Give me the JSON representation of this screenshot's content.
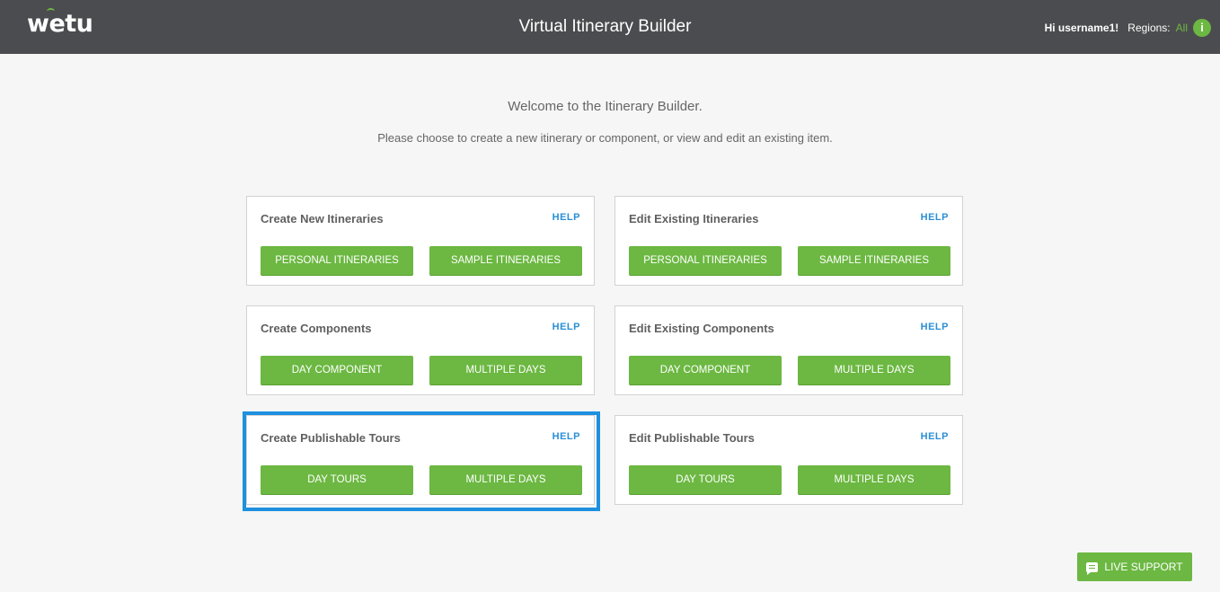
{
  "header": {
    "logo": "wetu",
    "title": "Virtual Itinerary Builder",
    "greeting": "Hi username1!",
    "regions_label": "Regions:",
    "regions_value": "All",
    "info_icon": "i"
  },
  "intro": {
    "welcome": "Welcome to the Itinerary Builder.",
    "subtitle": "Please choose to create a new itinerary or component, or view and edit an existing item."
  },
  "cards": [
    {
      "title": "Create New Itineraries",
      "help": "HELP",
      "buttons": [
        "PERSONAL ITINERARIES",
        "SAMPLE ITINERARIES"
      ]
    },
    {
      "title": "Edit Existing Itineraries",
      "help": "HELP",
      "buttons": [
        "PERSONAL ITINERARIES",
        "SAMPLE ITINERARIES"
      ]
    },
    {
      "title": "Create Components",
      "help": "HELP",
      "buttons": [
        "DAY COMPONENT",
        "MULTIPLE DAYS"
      ]
    },
    {
      "title": "Edit Existing Components",
      "help": "HELP",
      "buttons": [
        "DAY COMPONENT",
        "MULTIPLE DAYS"
      ]
    },
    {
      "title": "Create Publishable Tours",
      "help": "HELP",
      "buttons": [
        "DAY TOURS",
        "MULTIPLE DAYS"
      ]
    },
    {
      "title": "Edit Publishable Tours",
      "help": "HELP",
      "buttons": [
        "DAY TOURS",
        "MULTIPLE DAYS"
      ]
    }
  ],
  "live_support": {
    "label": "LIVE SUPPORT",
    "icon": "chat-icon"
  },
  "colors": {
    "header_bg": "#4b4c4f",
    "accent_green": "#6cb842",
    "help_blue": "#2b8fd6",
    "highlight_blue": "#1e90e0"
  }
}
